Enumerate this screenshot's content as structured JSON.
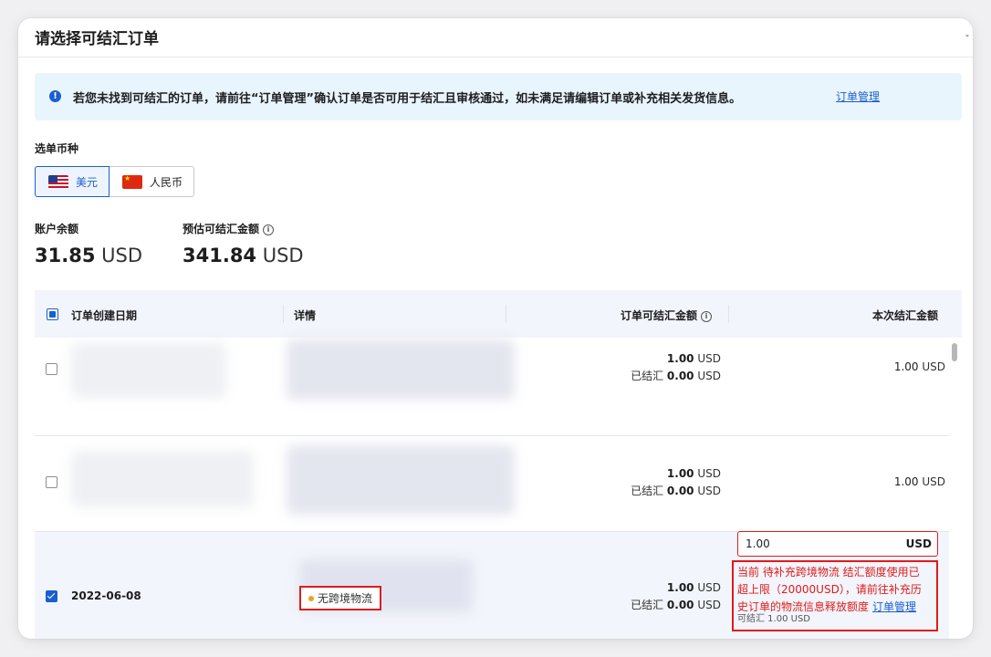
{
  "dialog": {
    "title": "请选择可结汇订单",
    "close_glyph": "-"
  },
  "notice": {
    "icon": "info-icon",
    "text": "若您未找到可结汇的订单，请前往“订单管理”确认订单是否可用于结汇且审核通过，如未满足请编辑订单或补充相关发货信息。",
    "link": "订单管理",
    "color": "#e9f5fd"
  },
  "currency": {
    "label": "选单币种",
    "options": [
      {
        "label": "美元",
        "flag": "us-flag-icon",
        "selected": true
      },
      {
        "label": "人民币",
        "flag": "cn-flag-icon",
        "selected": false
      }
    ]
  },
  "balance": {
    "account_label": "账户余额",
    "account_value": "31.85",
    "account_unit": "USD",
    "estimate_label": "预估可结汇金额",
    "estimate_value": "341.84",
    "estimate_unit": "USD"
  },
  "table": {
    "columns": [
      "订单创建日期",
      "详情",
      "订单可结汇金额",
      "本次结汇金额"
    ],
    "rows": [
      {
        "checked": false,
        "date": "",
        "amount": "1.00",
        "unit": "USD",
        "settled_label": "已结汇",
        "settled": "0.00",
        "settle_amount": "1.00"
      },
      {
        "checked": false,
        "date": "",
        "amount": "1.00",
        "unit": "USD",
        "settled_label": "已结汇",
        "settled": "0.00",
        "settle_amount": "1.00"
      },
      {
        "checked": true,
        "date": "2022-06-08",
        "amount": "1.00",
        "unit": "USD",
        "settled_label": "已结汇",
        "settled": "0.00",
        "badge": "无跨境物流",
        "input_value": "1.00",
        "input_suffix": "USD",
        "error_lines": [
          "当前 待补充跨境物流 结汇额度使用已",
          "超上限（20000USD），请前往补充历",
          "史订单的物流信息释放额度"
        ],
        "error_link": "订单管理",
        "available": "可结汇  1.00  USD"
      }
    ]
  },
  "colors": {
    "accent": "#1a5fd0",
    "error": "#e01b1b",
    "badge_dot": "#f0a020"
  }
}
